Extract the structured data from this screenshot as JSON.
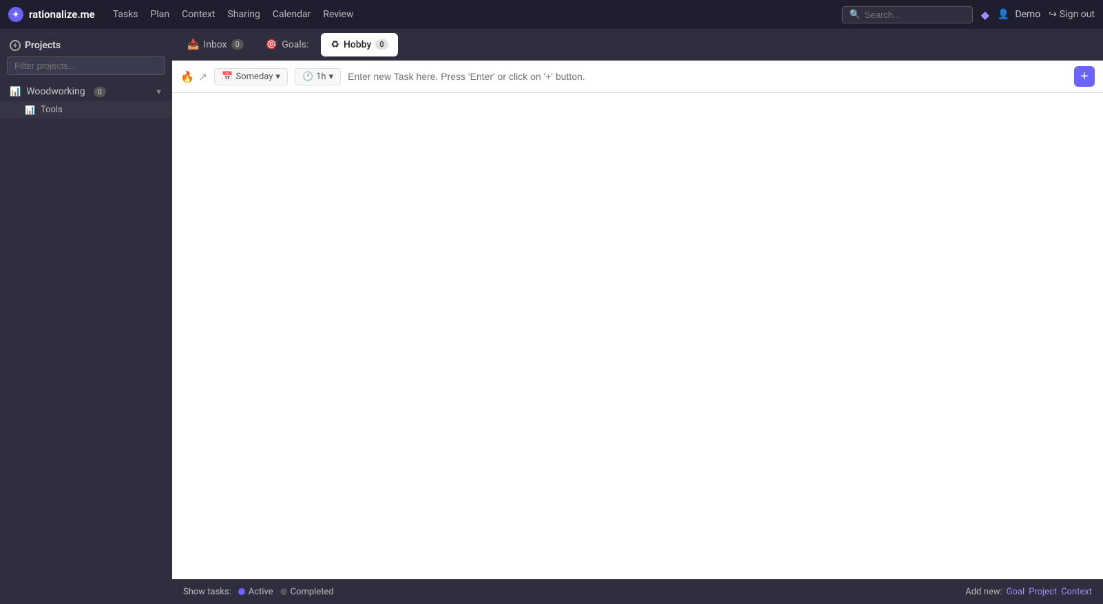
{
  "app": {
    "logo_text": "rationalize.me",
    "logo_symbol": "✦"
  },
  "topnav": {
    "links": [
      "Tasks",
      "Plan",
      "Context",
      "Sharing",
      "Calendar",
      "Review"
    ],
    "search_placeholder": "Search...",
    "diamond_icon": "◆",
    "user_label": "Demo",
    "signout_label": "Sign out",
    "signout_icon": "→"
  },
  "sidebar": {
    "header_label": "Projects",
    "add_icon": "+",
    "filter_placeholder": "Filter projects...",
    "projects": [
      {
        "name": "Woodworking",
        "badge": "0",
        "has_children": true,
        "expanded": true
      }
    ],
    "subprojects": [
      {
        "name": "Tools"
      }
    ]
  },
  "tabs": [
    {
      "id": "inbox",
      "icon": "📥",
      "label": "Inbox",
      "badge": "0",
      "active": false
    },
    {
      "id": "goals",
      "icon": "🎯",
      "label": "Goals:",
      "badge": null,
      "active": false
    },
    {
      "id": "hobby",
      "icon": "♻",
      "label": "Hobby",
      "badge": "0",
      "active": true
    }
  ],
  "task_input": {
    "fire_icon": "🔥",
    "arrow_icon": "↗",
    "schedule_label": "Someday",
    "schedule_icon": "▾",
    "duration_label": "1h",
    "duration_icon": "▾",
    "calendar_icon": "📅",
    "clock_icon": "🕐",
    "placeholder": "Enter new Task here. Press 'Enter' or click on '+' button.",
    "add_button": "+"
  },
  "bottom_bar": {
    "show_tasks_label": "Show tasks:",
    "active_label": "Active",
    "completed_label": "Completed",
    "add_new_label": "Add new:",
    "goal_link": "Goal",
    "project_link": "Project",
    "context_link": "Context"
  }
}
